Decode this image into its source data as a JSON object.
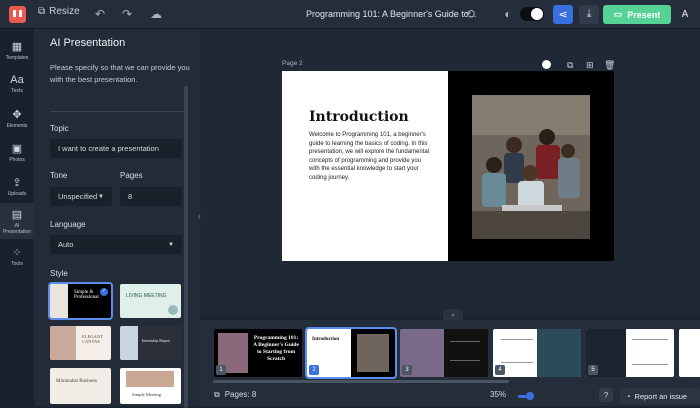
{
  "topbar": {
    "resize_label": "Resize",
    "document_title": "Programming 101: A Beginner's Guide to...",
    "present_label": "Present",
    "avatar_initial": "A"
  },
  "rail": {
    "items": [
      {
        "label": "Templates",
        "icon": "templates-icon"
      },
      {
        "label": "Texts",
        "icon": "text-icon"
      },
      {
        "label": "Elements",
        "icon": "elements-icon"
      },
      {
        "label": "Photos",
        "icon": "photo-icon"
      },
      {
        "label": "Uploads",
        "icon": "upload-icon"
      },
      {
        "label": "AI Presentation",
        "icon": "ai-presentation-icon"
      },
      {
        "label": "Tools",
        "icon": "tools-icon"
      }
    ]
  },
  "panel": {
    "title": "AI Presentation",
    "description": "Please specify so that we can provide you with the best presentation.",
    "topic_label": "Topic",
    "topic_value": "I want to create a presentation",
    "tone_label": "Tone",
    "tone_value": "Unspecified",
    "pages_label": "Pages",
    "pages_value": "8",
    "language_label": "Language",
    "language_value": "Auto",
    "style_label": "Style",
    "styles": [
      {
        "text": "Simple & Professional"
      },
      {
        "text": "LIVING MEETING"
      },
      {
        "text": "ELEGANT CANVAS"
      },
      {
        "text": "Internship Report"
      },
      {
        "text": "Minimalist Business"
      },
      {
        "text": "Simple Meeting"
      }
    ]
  },
  "canvas": {
    "page_label": "Page 2",
    "slide_title": "Introduction",
    "slide_body": "Welcome to Programming 101, a beginner's guide to learning the basics of coding. In this presentation, we will explore the fundamental concepts of programming and provide you with the essential knowledge to start your coding journey."
  },
  "strip": {
    "thumbs": [
      {
        "num": "1",
        "text": "Programming 101: A Beginner's Guide to Starting from Scratch"
      },
      {
        "num": "2",
        "text": "Introduction"
      },
      {
        "num": "3",
        "text": ""
      },
      {
        "num": "4",
        "text": ""
      },
      {
        "num": "5",
        "text": ""
      }
    ]
  },
  "bottom": {
    "pages_text": "Pages: 8",
    "zoom_text": "35%",
    "help": "?",
    "report_label": "Report an issue"
  },
  "colors": {
    "present": "#55d396",
    "accent": "#3a6fe2",
    "logo": "#ec5a4f"
  }
}
